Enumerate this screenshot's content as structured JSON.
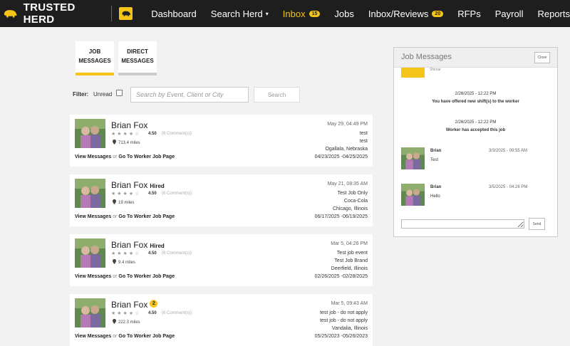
{
  "nav": {
    "brand": "TRUSTED HERD",
    "items": [
      {
        "label": "Dashboard"
      },
      {
        "label": "Search Herd",
        "caret": "▾"
      },
      {
        "label": "Inbox",
        "badge": "15"
      },
      {
        "label": "Jobs"
      },
      {
        "label": "Inbox/Reviews",
        "badge": "20"
      },
      {
        "label": "RFPs"
      },
      {
        "label": "Payroll"
      },
      {
        "label": "Reports"
      }
    ],
    "active_color": "#f4c418"
  },
  "tabs": [
    {
      "line1": "JOB",
      "line2": "MESSAGES"
    },
    {
      "line1": "DIRECT",
      "line2": "MESSAGES"
    }
  ],
  "filter": {
    "label": "Filter:",
    "unread_label": "Unread",
    "search_placeholder": "Search by Event, Client or City",
    "search_button": "Search"
  },
  "cards": [
    {
      "name": "Brian Fox",
      "hired": "",
      "badge": "",
      "stars": "★★★★☆",
      "rating": "4.50",
      "comments": "(6 Comment(s))",
      "miles": "713.4 miles",
      "view_link": "View Messages",
      "or_text": "or",
      "worker_link": "Go To Worker Job Page",
      "date": "May 29, 04:49 PM",
      "lines": [
        "test",
        "test",
        "Ogallala, Nebraska",
        "04/23/2025 -04/25/2025"
      ]
    },
    {
      "name": "Brian Fox",
      "hired": "Hired",
      "badge": "",
      "stars": "★★★★☆",
      "rating": "4.50",
      "comments": "(6 Comment(s))",
      "miles": "19 miles",
      "view_link": "View Messages",
      "or_text": "or",
      "worker_link": "Go To Worker Job Page",
      "date": "May 21, 08:35 AM",
      "lines": [
        "Test Job Only",
        "Coca-Cola",
        "Chicago, Illinois",
        "06/17/2025 -06/19/2025"
      ]
    },
    {
      "name": "Brian Fox",
      "hired": "Hired",
      "badge": "",
      "stars": "★★★★☆",
      "rating": "4.50",
      "comments": "(6 Comment(s))",
      "miles": "9.4 miles",
      "view_link": "View Messages",
      "or_text": "or",
      "worker_link": "Go To Worker Job Page",
      "date": "Mar 5, 04:26 PM",
      "lines": [
        "Test job event",
        "Test Job Brand",
        "Deerfield, Illinois",
        "02/26/2025 -02/28/2025"
      ]
    },
    {
      "name": "Brian Fox",
      "hired": "",
      "badge": "2",
      "stars": "★★★★☆",
      "rating": "4.50",
      "comments": "(6 Comment(s))",
      "miles": "222.3 miles",
      "view_link": "View Messages",
      "or_text": "or",
      "worker_link": "Go To Worker Job Page",
      "date": "Mar 5, 09:43 AM",
      "lines": [
        "test job - do not apply",
        "test job - do not apply",
        "Vandalia, Illinois",
        "05/25/2023 -05/26/2023"
      ]
    }
  ],
  "messages_panel": {
    "title": "Job Messages",
    "close": "Close",
    "partial_text": "Shirsar",
    "system": [
      {
        "time": "2/26/2025 - 12:22 PM",
        "text": "You have offered new shift(s) to the worker"
      },
      {
        "time": "2/26/2025 - 12:22 PM",
        "text": "Worker has accepted this job"
      }
    ],
    "messages": [
      {
        "name": "Brian",
        "time": "3/3/2025 - 09:55 AM",
        "text": "Test"
      },
      {
        "name": "Brian",
        "time": "3/5/2025 - 04:26 PM",
        "text": "Hello"
      }
    ],
    "reply_value": "",
    "send": "Send"
  },
  "colors": {
    "accent": "#f4c418",
    "nav_bg": "#1e1e1e"
  },
  "icons": [
    "bison-logo-icon",
    "star-icon",
    "location-pin-icon",
    "checkbox-icon"
  ]
}
